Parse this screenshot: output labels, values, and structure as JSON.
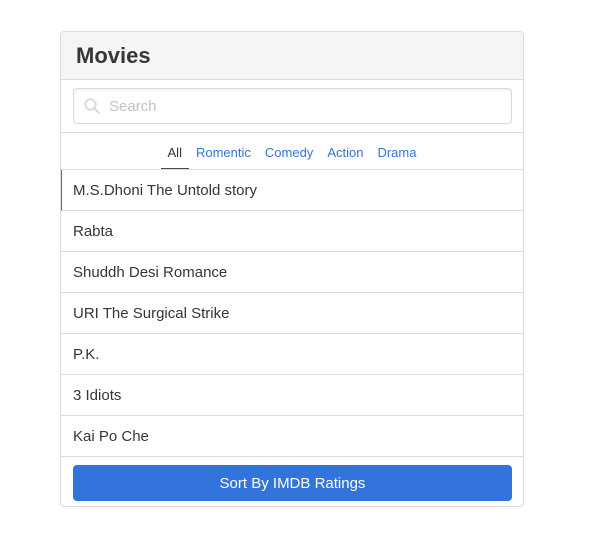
{
  "panel": {
    "title": "Movies"
  },
  "search": {
    "placeholder": "Search",
    "value": "",
    "icon": "search-icon"
  },
  "tabs": [
    {
      "label": "All",
      "active": true
    },
    {
      "label": "Romentic",
      "active": false
    },
    {
      "label": "Comedy",
      "active": false
    },
    {
      "label": "Action",
      "active": false
    },
    {
      "label": "Drama",
      "active": false
    }
  ],
  "movies": [
    {
      "title": "M.S.Dhoni The Untold story",
      "active": true
    },
    {
      "title": "Rabta",
      "active": false
    },
    {
      "title": "Shuddh Desi Romance",
      "active": false
    },
    {
      "title": "URI The Surgical Strike",
      "active": false
    },
    {
      "title": "P.K.",
      "active": false
    },
    {
      "title": "3 Idiots",
      "active": false
    },
    {
      "title": "Kai Po Che",
      "active": false
    }
  ],
  "footer": {
    "button_label": "Sort By IMDB Ratings"
  },
  "colors": {
    "link": "#3273dc",
    "border": "#dbdbdb",
    "heading_bg": "#f5f5f5",
    "button_bg": "#3273dc"
  }
}
